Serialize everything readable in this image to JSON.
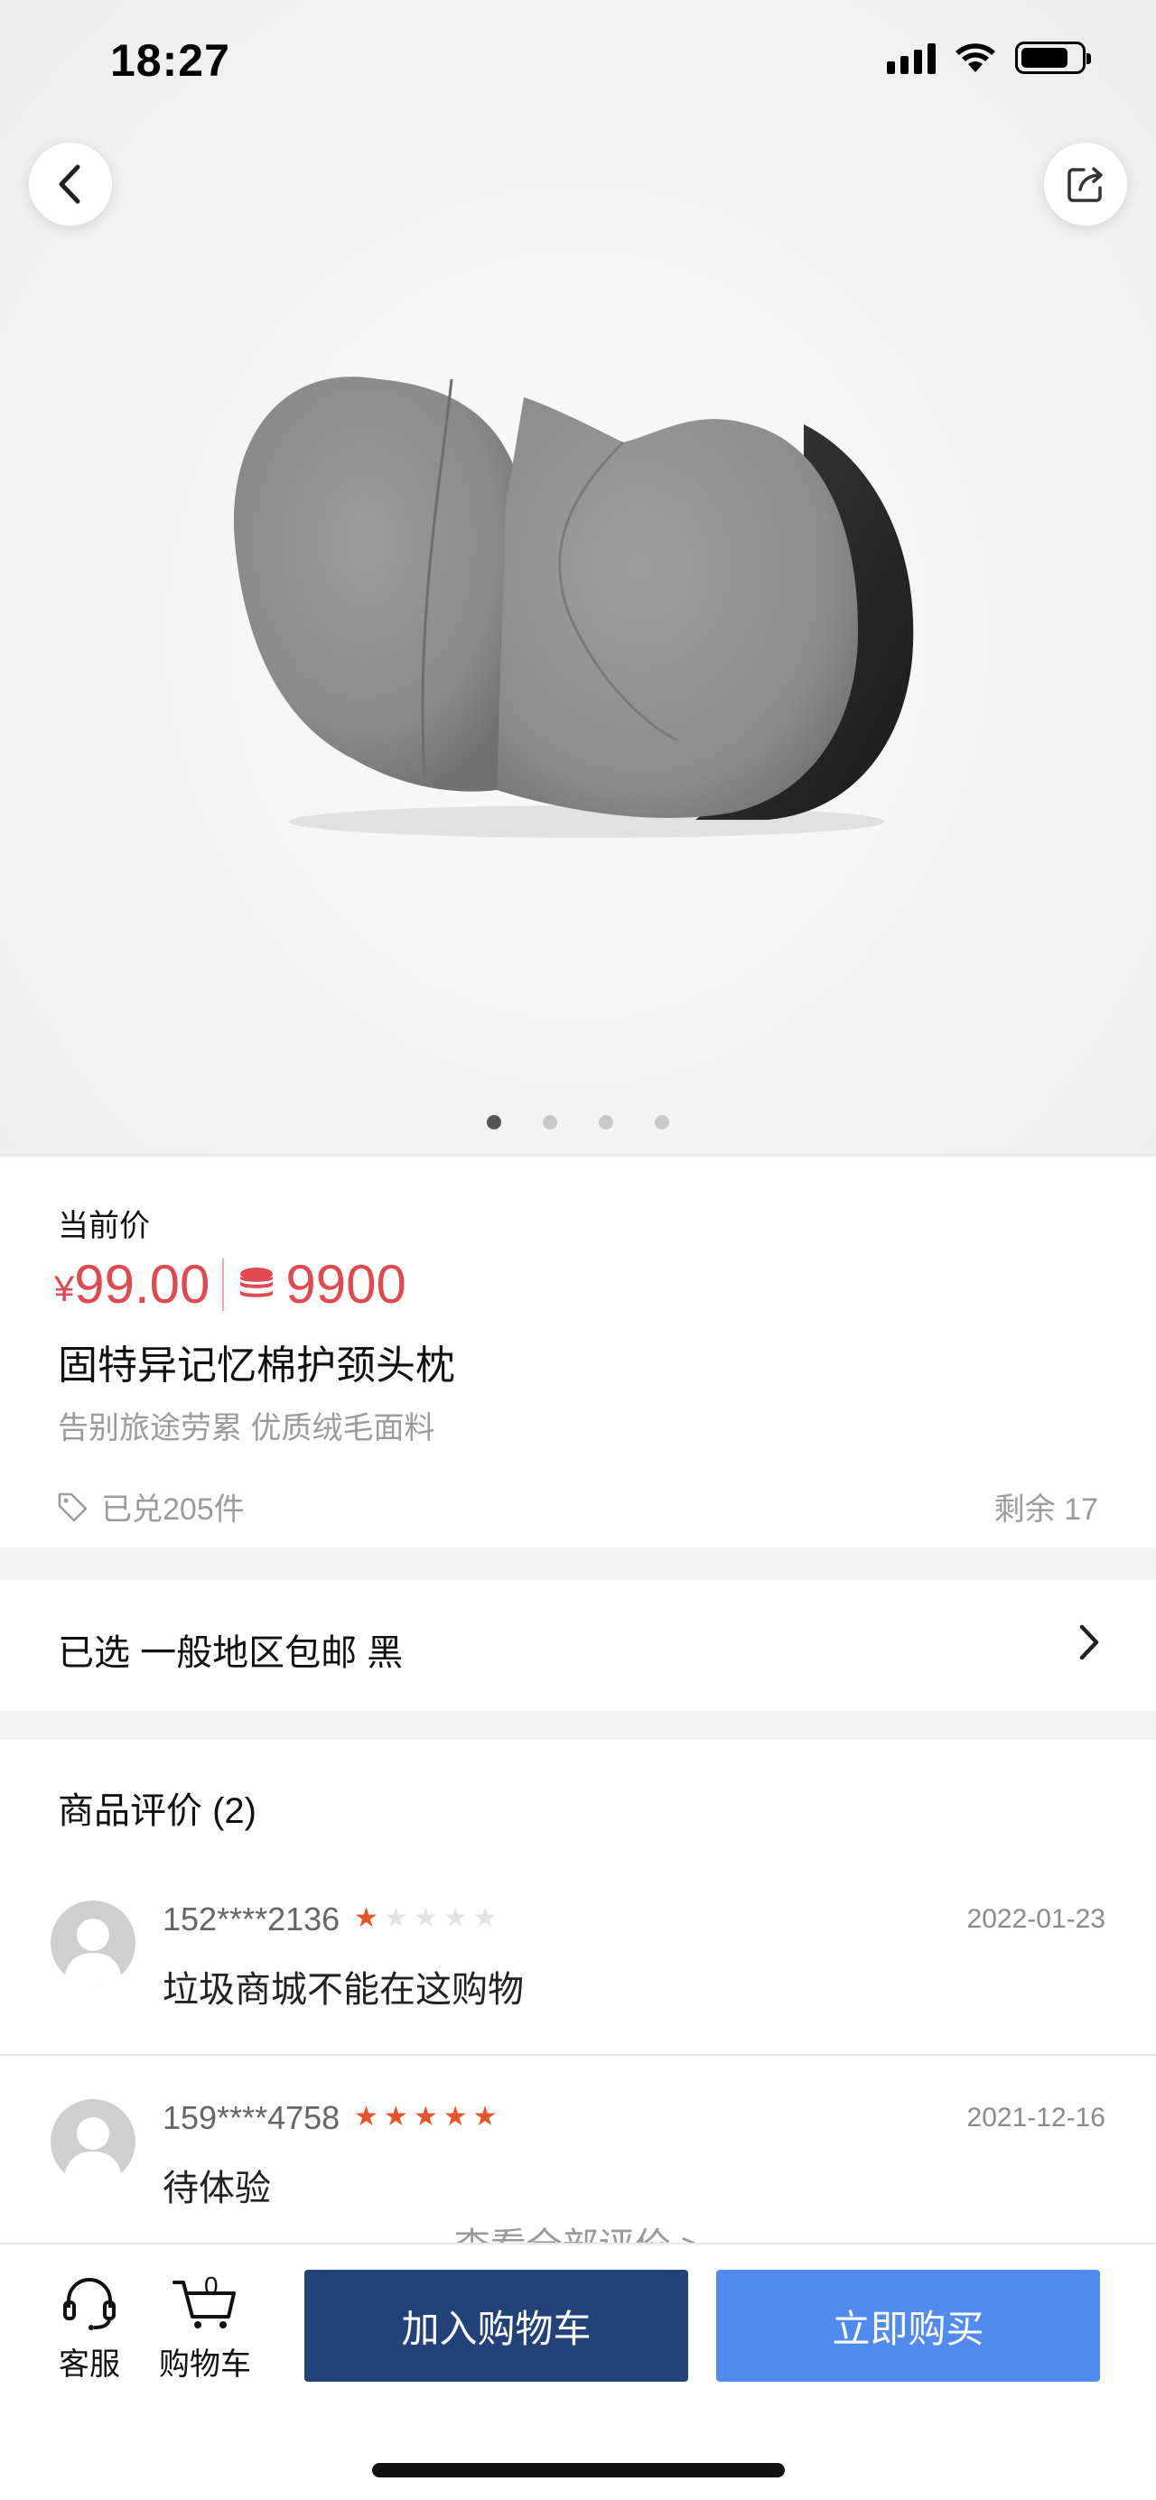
{
  "status_bar": {
    "time": "18:27"
  },
  "gallery": {
    "image_count": 4,
    "active_index": 0
  },
  "product": {
    "price_label": "当前价",
    "currency_symbol": "¥",
    "price": "99.00",
    "points": "9900",
    "title": "固特异记忆棉护颈头枕",
    "subtitle": "告别旅途劳累 优质绒毛面料",
    "redeemed": "已兑205件",
    "stock": "剩余 17"
  },
  "selection": {
    "text": "已选 一般地区包邮 黑"
  },
  "reviews": {
    "title": "商品评价 (2)",
    "items": [
      {
        "user": "152****2136",
        "rating": 1,
        "date": "2022-01-23",
        "text": "垃圾商城不能在这购物"
      },
      {
        "user": "159****4758",
        "rating": 5,
        "date": "2021-12-16",
        "text": "待体验"
      }
    ],
    "view_all": "查看全部评价 >"
  },
  "bottom_bar": {
    "service_label": "客服",
    "cart_label": "购物车",
    "cart_count": "0",
    "add_to_cart": "加入购物车",
    "buy_now": "立即购买"
  },
  "colors": {
    "price_red": "#e2484f",
    "star_orange": "#e9532c",
    "cart_button": "#23427a",
    "buy_button": "#518bf0"
  }
}
